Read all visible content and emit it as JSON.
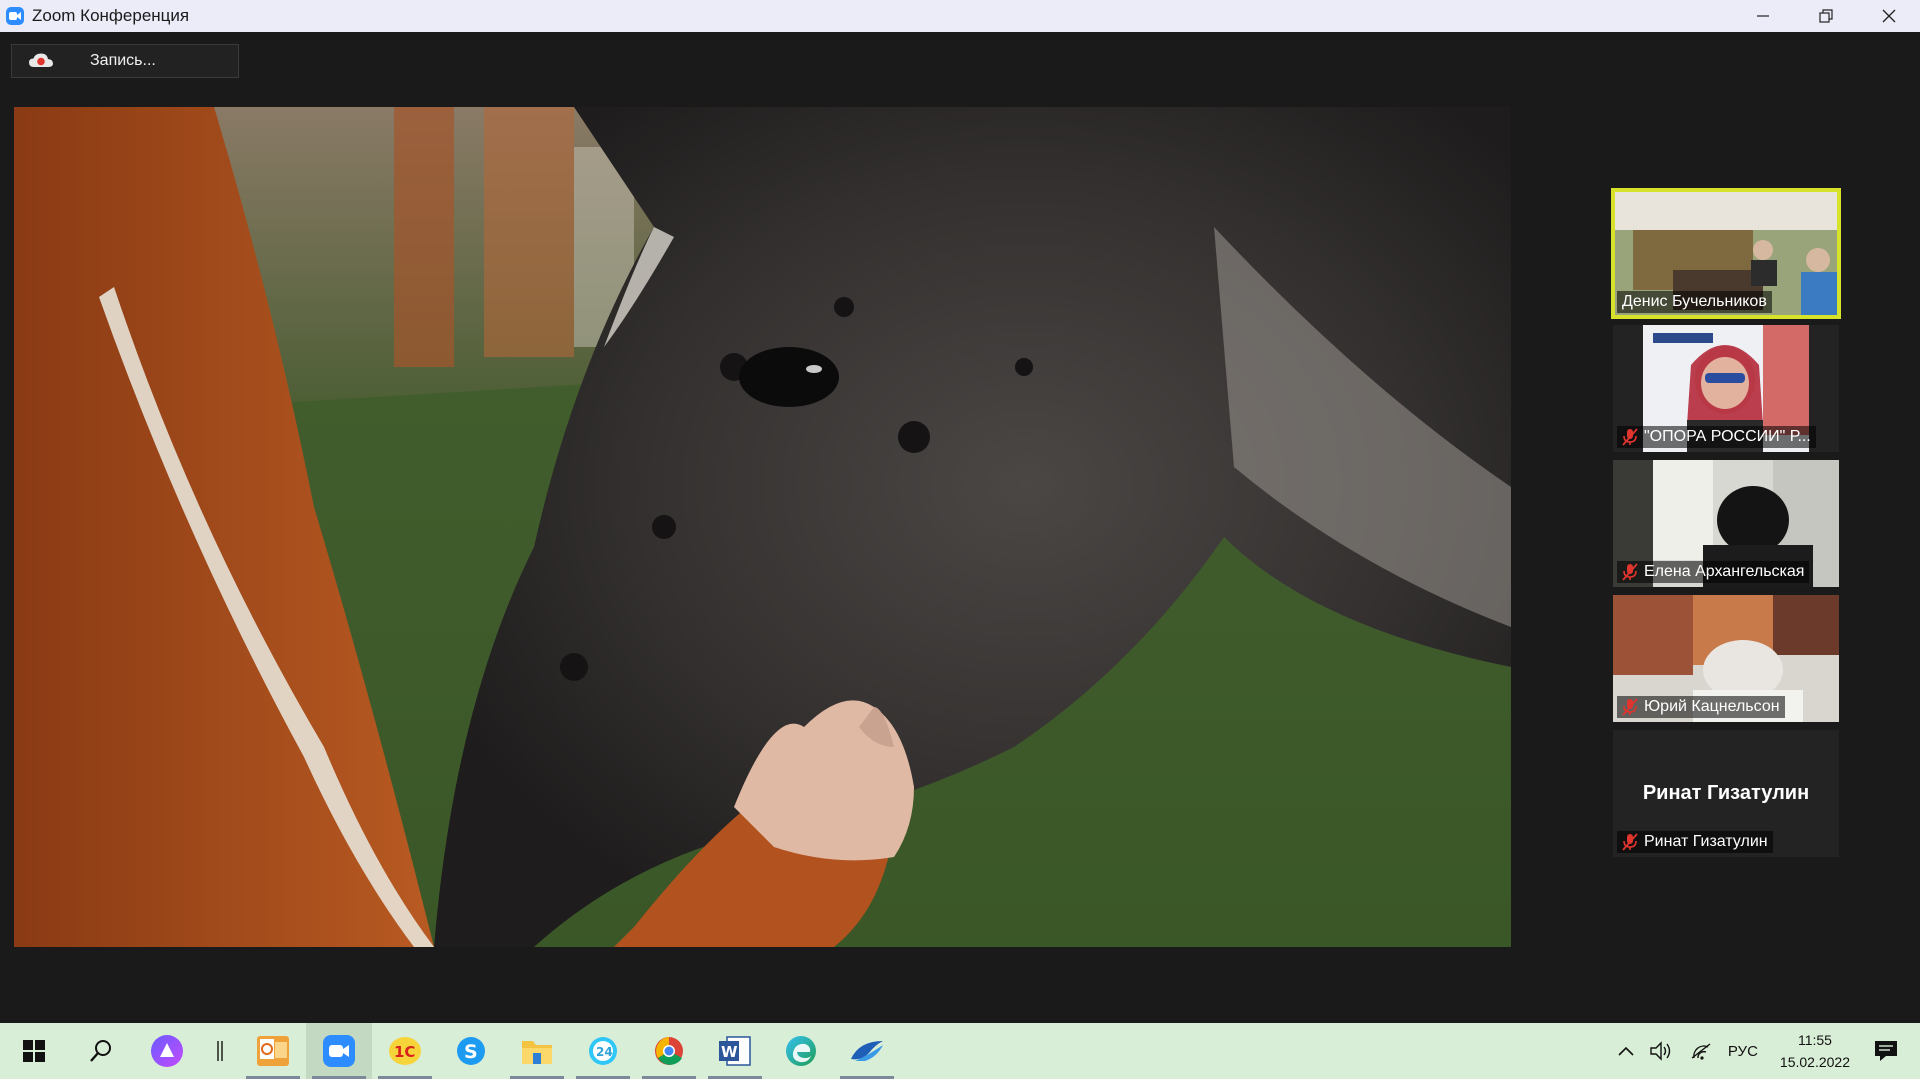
{
  "window": {
    "title": "Zoom Конференция",
    "controls": {
      "minimize": "minimize-icon",
      "restore": "restore-icon",
      "close": "close-icon"
    }
  },
  "recording": {
    "label": "Запись...",
    "icon": "cloud-record-icon"
  },
  "main_video": {
    "description_icon": "video-feed"
  },
  "gallery": [
    {
      "name": "Денис Бучельников",
      "active": true,
      "muted": false
    },
    {
      "name": "\"ОПОРА РОССИИ\" Р...",
      "active": false,
      "muted": true
    },
    {
      "name": "Елена Архангельская",
      "active": false,
      "muted": true
    },
    {
      "name": "Юрий Кацнельсон",
      "active": false,
      "muted": true
    },
    {
      "name": "Ринат Гизатулин",
      "active": false,
      "muted": true,
      "big_name": "Ринат Гизатулин"
    }
  ],
  "taskbar": {
    "apps": [
      {
        "name": "start-icon"
      },
      {
        "name": "search-icon"
      },
      {
        "name": "alice-icon"
      },
      {
        "name": "divider-icon"
      },
      {
        "name": "outlook-icon",
        "open": true
      },
      {
        "name": "zoom-icon",
        "open": true,
        "active": true
      },
      {
        "name": "1c-icon",
        "open": true
      },
      {
        "name": "skype-icon",
        "open": false
      },
      {
        "name": "explorer-icon",
        "open": true
      },
      {
        "name": "bitrix24-icon",
        "open": true
      },
      {
        "name": "chrome-icon",
        "open": true
      },
      {
        "name": "word-icon",
        "open": true
      },
      {
        "name": "edge-icon",
        "open": false
      },
      {
        "name": "app-swoosh-icon",
        "open": true
      }
    ],
    "tray": {
      "language": "РУС",
      "time": "11:55",
      "date": "15.02.2022"
    }
  },
  "colors": {
    "active_speaker_border": "#d7e32b",
    "mute_red": "#e0342e",
    "zoom_blue": "#2d8cff"
  }
}
